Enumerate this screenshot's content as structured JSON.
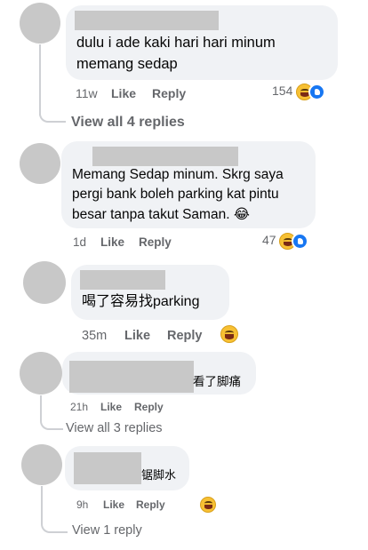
{
  "comments": [
    {
      "text_lines": [
        "dulu i ade kaki hari hari minum",
        "memang sedap"
      ],
      "time": "11w",
      "like_label": "Like",
      "reply_label": "Reply",
      "reaction_count": "154",
      "reactions": [
        "haha-emoji-icon",
        "like-reaction-icon"
      ]
    },
    {
      "text_lines": [
        "Memang Sedap minum. Skrg saya",
        "pergi bank boleh parking kat pintu",
        "besar tanpa takut Saman. 😂"
      ],
      "time": "1d",
      "like_label": "Like",
      "reply_label": "Reply",
      "reaction_count": "47",
      "reactions": [
        "haha-emoji-icon",
        "like-reaction-icon"
      ]
    },
    {
      "text_lines": [
        "喝了容易找parking"
      ],
      "time": "35m",
      "like_label": "Like",
      "reply_label": "Reply",
      "reactions": [
        "haha-emoji-icon"
      ]
    },
    {
      "text_lines": [
        "看了脚痛"
      ],
      "time": "21h",
      "like_label": "Like",
      "reply_label": "Reply"
    },
    {
      "text_lines": [
        "锯脚水"
      ],
      "time": "9h",
      "like_label": "Like",
      "reply_label": "Reply",
      "reactions": [
        "haha-emoji-icon"
      ]
    }
  ],
  "view_replies": [
    "View all 4 replies",
    "View all 3 replies",
    "View 1 reply"
  ],
  "colors": {
    "bubble": "#f0f2f5",
    "meta_text": "#65676b",
    "like_blue": "#1877f2",
    "placeholder_gray": "#c8c8c8"
  }
}
